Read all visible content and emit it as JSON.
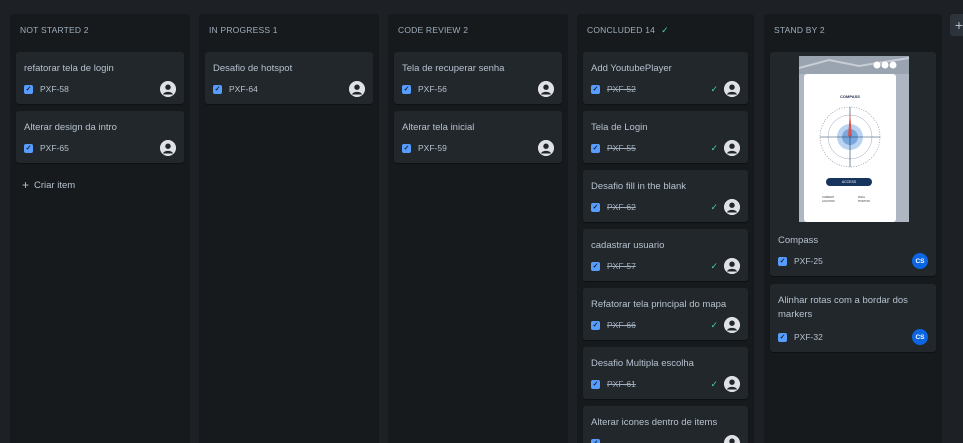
{
  "columns": [
    {
      "header": "NOT STARTED 2",
      "cards": [
        {
          "title": "refatorar tela de login",
          "key": "PXF-58",
          "done": false,
          "assignee": "avatar"
        },
        {
          "title": "Alterar design da intro",
          "key": "PXF-65",
          "done": false,
          "assignee": "avatar"
        }
      ],
      "create_label": "Criar item"
    },
    {
      "header": "IN PROGRESS 1",
      "cards": [
        {
          "title": "Desafio de hotspot",
          "key": "PXF-64",
          "done": false,
          "assignee": "avatar"
        }
      ]
    },
    {
      "header": "CODE REVIEW 2",
      "cards": [
        {
          "title": "Tela de recuperar senha",
          "key": "PXF-56",
          "done": false,
          "assignee": "avatar"
        },
        {
          "title": "Alterar tela inicial",
          "key": "PXF-59",
          "done": false,
          "assignee": "avatar"
        }
      ]
    },
    {
      "header": "CONCLUDED 14",
      "header_icon": "check-icon",
      "cards": [
        {
          "title": "Add YoutubePlayer",
          "key": "PXF-52",
          "done": true,
          "assignee": "avatar"
        },
        {
          "title": "Tela de Login",
          "key": "PXF-55",
          "done": true,
          "assignee": "avatar"
        },
        {
          "title": "Desafio fill in the blank",
          "key": "PXF-62",
          "done": true,
          "assignee": "avatar"
        },
        {
          "title": "cadastrar usuario",
          "key": "PXF-57",
          "done": true,
          "assignee": "avatar"
        },
        {
          "title": "Refatorar tela principal do mapa",
          "key": "PXF-66",
          "done": true,
          "assignee": "avatar"
        },
        {
          "title": "Desafio Multipla escolha",
          "key": "PXF-61",
          "done": true,
          "assignee": "avatar"
        },
        {
          "title": "Alterar icones dentro de items",
          "key": "",
          "done": true,
          "assignee": "avatar"
        }
      ]
    },
    {
      "header": "STAND BY 2",
      "cards": [
        {
          "title": "Compass",
          "key": "PXF-25",
          "done": false,
          "assignee": "CS",
          "thumbnail": {
            "screen_title": "COMPASS",
            "button_label": "ACCESS",
            "left_info": [
              "CURRENT",
              "LOCATION"
            ],
            "right_info": [
              "FINAL",
              "POSITION"
            ]
          }
        },
        {
          "title": "Alinhar rotas com a bordar dos markers",
          "key": "PXF-32",
          "done": false,
          "assignee": "CS"
        }
      ]
    }
  ],
  "colors": {
    "background": "#1d2125",
    "column": "#161a1d",
    "card": "#22272b",
    "checkbox": "#579dff",
    "done_check": "#4bce97",
    "cs_avatar": "#0c66e4"
  },
  "add_column_icon": "plus-icon"
}
